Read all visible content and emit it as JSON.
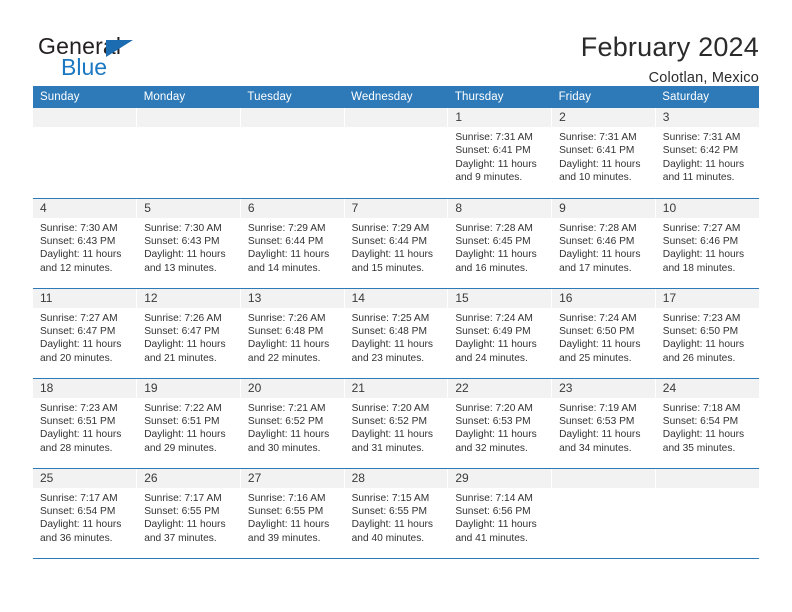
{
  "logo": {
    "primary_text": "General",
    "secondary_text": "Blue",
    "triangle_icon": "blue-triangle-icon",
    "primary_color": "#231f20",
    "secondary_color": "#1b78c2"
  },
  "header": {
    "title": "February 2024",
    "subtitle": "Colotlan, Mexico"
  },
  "theme": {
    "header_bar_color": "#2e7ab8",
    "day_band_color": "#f2f2f2",
    "row_divider_color": "#2e7ab8",
    "text_color": "#333333"
  },
  "calendar": {
    "weekday_headers": [
      "Sunday",
      "Monday",
      "Tuesday",
      "Wednesday",
      "Thursday",
      "Friday",
      "Saturday"
    ],
    "labels": {
      "sunrise": "Sunrise:",
      "sunset": "Sunset:",
      "daylight": "Daylight:"
    },
    "weeks": [
      [
        {
          "day": "",
          "empty": true
        },
        {
          "day": "",
          "empty": true
        },
        {
          "day": "",
          "empty": true
        },
        {
          "day": "",
          "empty": true
        },
        {
          "day": "1",
          "sunrise": "Sunrise: 7:31 AM",
          "sunset": "Sunset: 6:41 PM",
          "daylight_line1": "Daylight: 11 hours",
          "daylight_line2": "and 9 minutes."
        },
        {
          "day": "2",
          "sunrise": "Sunrise: 7:31 AM",
          "sunset": "Sunset: 6:41 PM",
          "daylight_line1": "Daylight: 11 hours",
          "daylight_line2": "and 10 minutes."
        },
        {
          "day": "3",
          "sunrise": "Sunrise: 7:31 AM",
          "sunset": "Sunset: 6:42 PM",
          "daylight_line1": "Daylight: 11 hours",
          "daylight_line2": "and 11 minutes."
        }
      ],
      [
        {
          "day": "4",
          "sunrise": "Sunrise: 7:30 AM",
          "sunset": "Sunset: 6:43 PM",
          "daylight_line1": "Daylight: 11 hours",
          "daylight_line2": "and 12 minutes."
        },
        {
          "day": "5",
          "sunrise": "Sunrise: 7:30 AM",
          "sunset": "Sunset: 6:43 PM",
          "daylight_line1": "Daylight: 11 hours",
          "daylight_line2": "and 13 minutes."
        },
        {
          "day": "6",
          "sunrise": "Sunrise: 7:29 AM",
          "sunset": "Sunset: 6:44 PM",
          "daylight_line1": "Daylight: 11 hours",
          "daylight_line2": "and 14 minutes."
        },
        {
          "day": "7",
          "sunrise": "Sunrise: 7:29 AM",
          "sunset": "Sunset: 6:44 PM",
          "daylight_line1": "Daylight: 11 hours",
          "daylight_line2": "and 15 minutes."
        },
        {
          "day": "8",
          "sunrise": "Sunrise: 7:28 AM",
          "sunset": "Sunset: 6:45 PM",
          "daylight_line1": "Daylight: 11 hours",
          "daylight_line2": "and 16 minutes."
        },
        {
          "day": "9",
          "sunrise": "Sunrise: 7:28 AM",
          "sunset": "Sunset: 6:46 PM",
          "daylight_line1": "Daylight: 11 hours",
          "daylight_line2": "and 17 minutes."
        },
        {
          "day": "10",
          "sunrise": "Sunrise: 7:27 AM",
          "sunset": "Sunset: 6:46 PM",
          "daylight_line1": "Daylight: 11 hours",
          "daylight_line2": "and 18 minutes."
        }
      ],
      [
        {
          "day": "11",
          "sunrise": "Sunrise: 7:27 AM",
          "sunset": "Sunset: 6:47 PM",
          "daylight_line1": "Daylight: 11 hours",
          "daylight_line2": "and 20 minutes."
        },
        {
          "day": "12",
          "sunrise": "Sunrise: 7:26 AM",
          "sunset": "Sunset: 6:47 PM",
          "daylight_line1": "Daylight: 11 hours",
          "daylight_line2": "and 21 minutes."
        },
        {
          "day": "13",
          "sunrise": "Sunrise: 7:26 AM",
          "sunset": "Sunset: 6:48 PM",
          "daylight_line1": "Daylight: 11 hours",
          "daylight_line2": "and 22 minutes."
        },
        {
          "day": "14",
          "sunrise": "Sunrise: 7:25 AM",
          "sunset": "Sunset: 6:48 PM",
          "daylight_line1": "Daylight: 11 hours",
          "daylight_line2": "and 23 minutes."
        },
        {
          "day": "15",
          "sunrise": "Sunrise: 7:24 AM",
          "sunset": "Sunset: 6:49 PM",
          "daylight_line1": "Daylight: 11 hours",
          "daylight_line2": "and 24 minutes."
        },
        {
          "day": "16",
          "sunrise": "Sunrise: 7:24 AM",
          "sunset": "Sunset: 6:50 PM",
          "daylight_line1": "Daylight: 11 hours",
          "daylight_line2": "and 25 minutes."
        },
        {
          "day": "17",
          "sunrise": "Sunrise: 7:23 AM",
          "sunset": "Sunset: 6:50 PM",
          "daylight_line1": "Daylight: 11 hours",
          "daylight_line2": "and 26 minutes."
        }
      ],
      [
        {
          "day": "18",
          "sunrise": "Sunrise: 7:23 AM",
          "sunset": "Sunset: 6:51 PM",
          "daylight_line1": "Daylight: 11 hours",
          "daylight_line2": "and 28 minutes."
        },
        {
          "day": "19",
          "sunrise": "Sunrise: 7:22 AM",
          "sunset": "Sunset: 6:51 PM",
          "daylight_line1": "Daylight: 11 hours",
          "daylight_line2": "and 29 minutes."
        },
        {
          "day": "20",
          "sunrise": "Sunrise: 7:21 AM",
          "sunset": "Sunset: 6:52 PM",
          "daylight_line1": "Daylight: 11 hours",
          "daylight_line2": "and 30 minutes."
        },
        {
          "day": "21",
          "sunrise": "Sunrise: 7:20 AM",
          "sunset": "Sunset: 6:52 PM",
          "daylight_line1": "Daylight: 11 hours",
          "daylight_line2": "and 31 minutes."
        },
        {
          "day": "22",
          "sunrise": "Sunrise: 7:20 AM",
          "sunset": "Sunset: 6:53 PM",
          "daylight_line1": "Daylight: 11 hours",
          "daylight_line2": "and 32 minutes."
        },
        {
          "day": "23",
          "sunrise": "Sunrise: 7:19 AM",
          "sunset": "Sunset: 6:53 PM",
          "daylight_line1": "Daylight: 11 hours",
          "daylight_line2": "and 34 minutes."
        },
        {
          "day": "24",
          "sunrise": "Sunrise: 7:18 AM",
          "sunset": "Sunset: 6:54 PM",
          "daylight_line1": "Daylight: 11 hours",
          "daylight_line2": "and 35 minutes."
        }
      ],
      [
        {
          "day": "25",
          "sunrise": "Sunrise: 7:17 AM",
          "sunset": "Sunset: 6:54 PM",
          "daylight_line1": "Daylight: 11 hours",
          "daylight_line2": "and 36 minutes."
        },
        {
          "day": "26",
          "sunrise": "Sunrise: 7:17 AM",
          "sunset": "Sunset: 6:55 PM",
          "daylight_line1": "Daylight: 11 hours",
          "daylight_line2": "and 37 minutes."
        },
        {
          "day": "27",
          "sunrise": "Sunrise: 7:16 AM",
          "sunset": "Sunset: 6:55 PM",
          "daylight_line1": "Daylight: 11 hours",
          "daylight_line2": "and 39 minutes."
        },
        {
          "day": "28",
          "sunrise": "Sunrise: 7:15 AM",
          "sunset": "Sunset: 6:55 PM",
          "daylight_line1": "Daylight: 11 hours",
          "daylight_line2": "and 40 minutes."
        },
        {
          "day": "29",
          "sunrise": "Sunrise: 7:14 AM",
          "sunset": "Sunset: 6:56 PM",
          "daylight_line1": "Daylight: 11 hours",
          "daylight_line2": "and 41 minutes."
        },
        {
          "day": "",
          "empty": true
        },
        {
          "day": "",
          "empty": true
        }
      ]
    ]
  }
}
